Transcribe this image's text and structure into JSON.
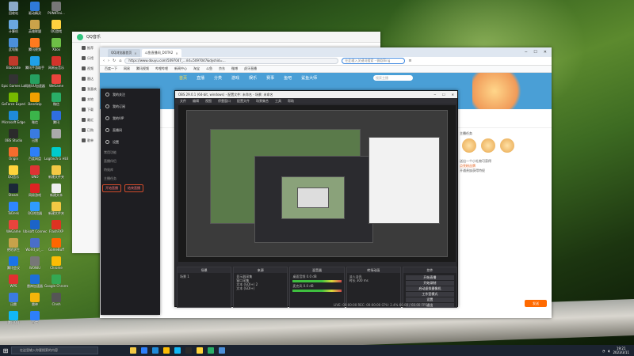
{
  "desktop_icons": [
    {
      "label": "回收站",
      "color": "#8aa9c8"
    },
    {
      "label": "驱动精灵",
      "color": "#2f7ad8"
    },
    {
      "label": "PUNKTrai...",
      "color": "#777"
    },
    {
      "label": "计算机",
      "color": "#6aa8e0"
    },
    {
      "label": "英雄联盟",
      "color": "#caa34a"
    },
    {
      "label": "QQ游戏",
      "color": "#ffd23f"
    },
    {
      "label": "此电脑",
      "color": "#4b8fd9"
    },
    {
      "label": "腾讯视频",
      "color": "#ff7a1e"
    },
    {
      "label": "Xbox",
      "color": "#6dbf46"
    },
    {
      "label": "Blacksite",
      "color": "#c03a2b"
    },
    {
      "label": "腾讯手游助手",
      "color": "#1fa0e8"
    },
    {
      "label": "网易云音乐",
      "color": "#d4332b"
    },
    {
      "label": "Epic Games Launcher",
      "color": "#333"
    },
    {
      "label": "网易UU加速器",
      "color": "#26a060"
    },
    {
      "label": "WeGame",
      "color": "#e9443c"
    },
    {
      "label": "GeForce Experience",
      "color": "#76b900"
    },
    {
      "label": "Bandizip",
      "color": "#f0a000"
    },
    {
      "label": "微信",
      "color": "#2aae67"
    },
    {
      "label": "Microsoft Edge",
      "color": "#1f8ad8"
    },
    {
      "label": "微信",
      "color": "#3bb54a"
    },
    {
      "label": "腾讯",
      "color": "#2f6ee0"
    },
    {
      "label": "OBS Studio",
      "color": "#2b2b2b"
    },
    {
      "label": "迅雷",
      "color": "#3a7be0"
    },
    {
      "label": "",
      "color": "#aaa"
    },
    {
      "label": "Origin",
      "color": "#f56c2d"
    },
    {
      "label": "百度网盘",
      "color": "#2d7ff9"
    },
    {
      "label": "Logitech G HUB",
      "color": "#0cc"
    },
    {
      "label": "QQ音乐",
      "color": "#ffd43b"
    },
    {
      "label": "UNO",
      "color": "#d33"
    },
    {
      "label": "新建文件夹",
      "color": "#f3c844"
    },
    {
      "label": "Steam",
      "color": "#1b2838"
    },
    {
      "label": "网易游戏",
      "color": "#d22"
    },
    {
      "label": "新建文本",
      "color": "#eee"
    },
    {
      "label": "ToDesk",
      "color": "#2f86ff"
    },
    {
      "label": "QQ浏览器",
      "color": "#2f9bff"
    },
    {
      "label": "新建文件夹",
      "color": "#f3c844"
    },
    {
      "label": "WeGame",
      "color": "#e9443c"
    },
    {
      "label": "Ubisoft Connect",
      "color": "#1c64c8"
    },
    {
      "label": "FlashFXP",
      "color": "#d32"
    },
    {
      "label": "绝地求生",
      "color": "#c8a24a"
    },
    {
      "label": "World_of_...",
      "color": "#4a6ec8"
    },
    {
      "label": "GameBuff",
      "color": "#f60"
    },
    {
      "label": "腾讯会议",
      "color": "#1a73e8"
    },
    {
      "label": "WONIU",
      "color": "#777"
    },
    {
      "label": "Chrome",
      "color": "#fbbc05"
    },
    {
      "label": "WPS",
      "color": "#e03030"
    },
    {
      "label": "雷神加速器",
      "color": "#1d6fd6"
    },
    {
      "label": "Google Chrome",
      "color": "#34a853"
    },
    {
      "label": "迅雷",
      "color": "#3a7be0"
    },
    {
      "label": "雷神",
      "color": "#f5b50a"
    },
    {
      "label": "Clash",
      "color": "#555"
    },
    {
      "label": "腾讯QQ",
      "color": "#12b7f5"
    },
    {
      "label": "百度",
      "color": "#2d7ff9"
    }
  ],
  "qqmusic": {
    "title": "QQ音乐",
    "side": [
      "推荐",
      "乐馆",
      "视频",
      "雷达",
      "我喜欢",
      "本地",
      "下载",
      "最近",
      "已购",
      "歌单"
    ]
  },
  "browser": {
    "tabs": [
      {
        "label": "QQ浏览器首页",
        "active": false
      },
      {
        "label": "斗鱼直播间_DOTA2",
        "active": true
      }
    ],
    "url": "https://www.douyu.com/5097047_...rid=5097047&dyshid=...",
    "search_placeholder": "在此输入关键词搜索 - 微软Bing",
    "bookmarks": [
      "百度一下",
      "网易",
      "腾讯视频",
      "哔哩哔哩",
      "新闻中心",
      "淘宝",
      "斗鱼",
      "京东",
      "微博",
      "虎牙直播"
    ],
    "douyu_nav": [
      "首页",
      "直播",
      "分类",
      "游戏",
      "娱乐",
      "赛事",
      "鱼吧",
      "鲨鱼大师"
    ],
    "douyu_search": "搜索主播",
    "side_title": "主播任务",
    "promo": [
      "送出一个小礼物可获得",
      "点亮粉丝牌",
      "开通贵族获得特权"
    ],
    "send_label": "发送"
  },
  "obs": {
    "title": "OBS 29.0.1 (64-bit, windows) - 配置文件: 未命名 - 场景: 未命名",
    "menu": [
      "文件",
      "编辑",
      "视图",
      "停靠窗口",
      "配置文件",
      "场景集合",
      "工具",
      "帮助"
    ],
    "docks": [
      {
        "title": "场景",
        "lines": [
          "场景 1"
        ]
      },
      {
        "title": "来源",
        "lines": [
          "显示器采集",
          "窗口采集",
          "文本 (GDI+) 2",
          "文本 (GDI+)"
        ]
      },
      {
        "title": "混音器",
        "lines": [
          "桌面音频 0.0 dB",
          "麦克风 0.0 dB"
        ]
      },
      {
        "title": "转场动画",
        "lines": [
          "淡入淡出",
          "时长 300 ms"
        ]
      },
      {
        "title": "控件",
        "buttons": [
          "开始直播",
          "开始录制",
          "启动虚拟摄像机",
          "工作室模式",
          "设置",
          "退出"
        ]
      }
    ],
    "status": "LIVE: 00:00:00  REC: 00:00:00  CPU: 2.4%  60.00 / 60.00 FPS"
  },
  "qqpanel": {
    "items": [
      "我的关注",
      "我的订阅",
      "我的VIP",
      "直播间",
      "设置"
    ],
    "sections": [
      "常用功能",
      "直播伴侣",
      "特效库",
      "主播任务"
    ],
    "buttons": [
      "开始直播",
      "结束直播"
    ]
  },
  "taskbar": {
    "search_placeholder": "在这里输入你要搜索的内容",
    "apps": [
      {
        "color": "#f3c844"
      },
      {
        "color": "#2d7ff9"
      },
      {
        "color": "#1f8ad8"
      },
      {
        "color": "#fbbc05"
      },
      {
        "color": "#12b7f5"
      },
      {
        "color": "#2b2b2b"
      },
      {
        "color": "#ffd43b"
      },
      {
        "color": "#2aae67"
      },
      {
        "color": "#4b8fd9"
      }
    ],
    "time": "19:21",
    "date": "2023/3/11"
  }
}
